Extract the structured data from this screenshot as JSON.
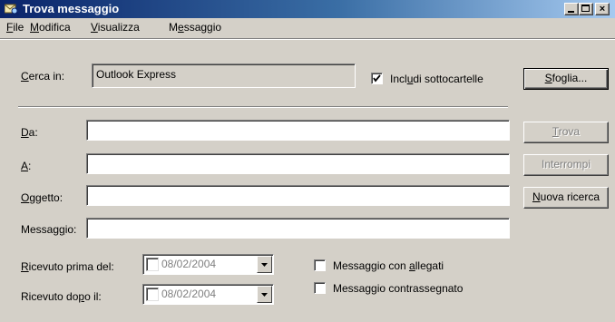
{
  "window": {
    "title": "Trova messaggio",
    "minimize": "_",
    "close": "×"
  },
  "menu": {
    "file": {
      "label": "File",
      "accel": "F",
      "rest": "ile"
    },
    "modifica": {
      "label": "Modifica",
      "accel": "M",
      "rest": "odifica"
    },
    "visualizza": {
      "label": "Visualizza",
      "accel": "V",
      "rest": "isualizza"
    },
    "messaggio": {
      "label": "Messaggio",
      "pre": "M",
      "accel": "e",
      "rest": "ssaggio"
    }
  },
  "search_in": {
    "label_accel": "C",
    "label_rest": "erca in:",
    "value": "Outlook Express"
  },
  "include_subfolders": {
    "checked": true,
    "pre": "Incl",
    "accel": "u",
    "rest": "di sottocartelle"
  },
  "fields": {
    "da": {
      "accel": "D",
      "rest": "a:",
      "value": ""
    },
    "a": {
      "accel": "A",
      "rest": ":",
      "value": ""
    },
    "oggetto": {
      "accel": "O",
      "rest": "ggetto:",
      "value": ""
    },
    "messaggio": {
      "pre": "Messag",
      "accel": "g",
      "rest": "io:",
      "value": ""
    }
  },
  "received_before": {
    "accel": "R",
    "rest": "icevuto prima del:",
    "date": "08/02/2004"
  },
  "received_after": {
    "pre": "Ricevuto do",
    "accel": "p",
    "rest": "o il:",
    "date": "08/02/2004"
  },
  "with_attachments": {
    "checked": false,
    "pre": "Messaggio con ",
    "accel": "a",
    "rest": "llegati"
  },
  "flagged": {
    "checked": false,
    "label": "Messaggio contrassegnato"
  },
  "buttons": {
    "sfoglia": {
      "accel": "S",
      "rest": "foglia..."
    },
    "trova": {
      "accel": "T",
      "rest": "rova",
      "enabled": false
    },
    "interrompi": {
      "label": "Interrompi",
      "enabled": false
    },
    "nuova_ricerca": {
      "accel": "N",
      "rest": "uova ricerca"
    }
  },
  "colors": {
    "face": "#d4d0c8",
    "title_start": "#0a246a",
    "title_end": "#a6caf0",
    "disabled_text": "#808080"
  }
}
